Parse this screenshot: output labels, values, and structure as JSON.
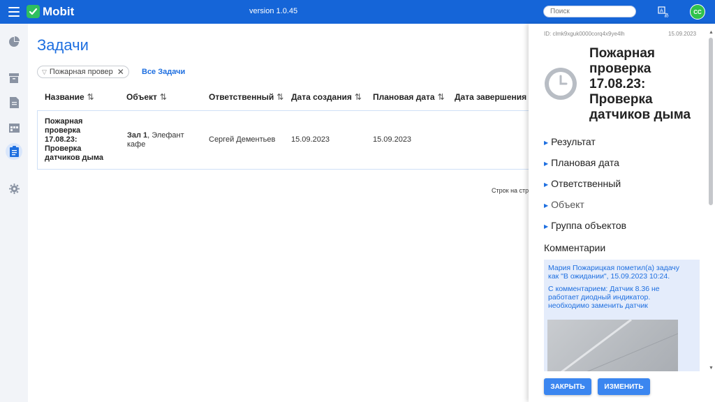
{
  "header": {
    "app_name": "Mobit",
    "version": "version 1.0.45",
    "search_placeholder": "Поиск",
    "avatar_initials": "CC",
    "brand_color": "#1565d8"
  },
  "sidebar": {
    "items": [
      {
        "icon": "pie-chart-icon",
        "active": false
      },
      {
        "icon": "archive-icon",
        "active": false
      },
      {
        "icon": "document-icon",
        "active": false
      },
      {
        "icon": "calendar-icon",
        "active": false
      },
      {
        "icon": "clipboard-icon",
        "active": true
      },
      {
        "icon": "gear-icon",
        "active": false
      }
    ]
  },
  "main": {
    "title": "Задачи",
    "filter_chip": "Пожарная провер",
    "all_tasks_link": "Все Задачи",
    "columns": [
      "Название",
      "Объект",
      "Ответственный",
      "Дата создания",
      "Плановая дата",
      "Дата завершения"
    ],
    "rows": [
      {
        "name_lines": [
          "Пожарная",
          "проверка",
          "17.08.23:",
          "Проверка",
          "датчиков дыма"
        ],
        "object_bold": "Зал 1",
        "object_rest": ", Элефант",
        "object_line2": "кафе",
        "responsible": "Сергей Дементьев",
        "created": "15.09.2023",
        "planned": "15.09.2023"
      }
    ],
    "rows_per_page_label": "Строк на стр"
  },
  "panel": {
    "id_label": "ID: clmk9xguk0000corq4x9ye4lh",
    "date": "15.09.2023",
    "title_lines": [
      "Пожарная",
      "проверка",
      "17.08.23:",
      "Проверка",
      "датчиков дыма"
    ],
    "sections": [
      "Результат",
      "Плановая дата",
      "Ответственный",
      "Объект",
      "Группа объектов"
    ],
    "comments_heading": "Комментарии",
    "comment_lines_1": [
      "Мария Пожарицкая пометил(а) задачу",
      "как \"В ожидании\", 15.09.2023 10:24."
    ],
    "comment_lines_2": [
      "С комментарием: Датчик 8.36 не",
      "работает диодный индикатор.",
      "необходимо заменить датчик"
    ],
    "close_button": "ЗАКРЫТЬ",
    "edit_button": "ИЗМЕНИТЬ"
  }
}
